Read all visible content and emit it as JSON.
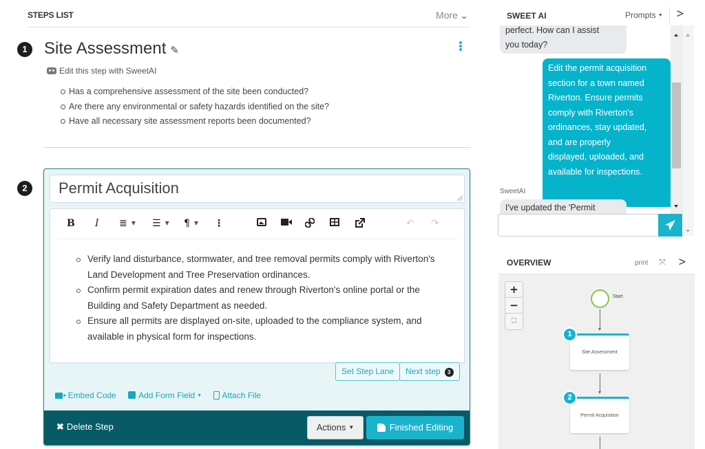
{
  "steps_list": {
    "title": "STEPS LIST",
    "more_label": "More",
    "more_icon": "chevron-down-icon"
  },
  "step1": {
    "number": "1",
    "title": "Site Assessment",
    "edit_with_ai_label": "Edit this step with SweetAI",
    "items": [
      "Has a comprehensive assessment of the site been conducted?",
      "Are there any environmental or safety hazards identified on the site?",
      "Have all necessary site assessment reports been documented?"
    ]
  },
  "step2": {
    "number": "2",
    "title_value": "Permit Acquisition",
    "toolbar": {
      "bold": "B",
      "italic": "I",
      "ordered_list": "≣",
      "unordered_list": "☰",
      "paragraph": "¶",
      "more": "⋮",
      "image_icon": "image-icon",
      "video_icon": "video-icon",
      "link_icon": "link-icon",
      "table_icon": "table-icon",
      "external_icon": "external-link-icon",
      "undo": "↶",
      "redo": "↷"
    },
    "body_items": [
      "Verify land disturbance, stormwater, and tree removal permits comply with Riverton's Land Development and Tree Preservation ordinances.",
      "Confirm permit expiration dates and renew through Riverton's online portal or the Building and Safety Department as needed.",
      "Ensure all permits are displayed on-site, uploaded to the compliance system, and available in physical form for inspections."
    ],
    "set_step_lane_label": "Set Step Lane",
    "next_step_label": "Next step",
    "next_step_number": "3",
    "embed_code_label": "Embed Code",
    "add_form_field_label": "Add Form Field",
    "attach_file_label": "Attach File",
    "delete_step_label": "Delete Step",
    "actions_label": "Actions",
    "finished_editing_label": "Finished Editing"
  },
  "sweet_ai": {
    "title": "SWEET AI",
    "prompts_label": "Prompts",
    "messages": [
      {
        "role": "ai",
        "text_lines": [
          "perfect. How can I assist",
          "you today?"
        ]
      },
      {
        "role": "user",
        "text_lines": [
          "Edit the permit acquisition",
          "section for a town named",
          "Riverton. Ensure permits",
          "comply with Riverton's",
          "ordinances, stay updated,",
          "and are properly",
          "displayed, uploaded, and",
          "available for inspections."
        ]
      },
      {
        "role": "ai",
        "sender": "SweetAI",
        "text_lines": [
          "I've updated the 'Permit"
        ]
      }
    ],
    "input_value": "",
    "input_placeholder": ""
  },
  "overview": {
    "title": "OVERVIEW",
    "print_label": "print",
    "zoom_in": "+",
    "zoom_out": "−",
    "fit": "⛶",
    "start_label": "Start",
    "nodes": [
      {
        "number": "1",
        "label": "Site Assessment"
      },
      {
        "number": "2",
        "label": "Permit Acquisition"
      }
    ]
  },
  "colors": {
    "accent": "#1ab3cc",
    "footer_bar": "#075a66",
    "user_bubble": "#05b3cb",
    "ai_bubble": "#e8eaed",
    "start_node": "#8bc34a"
  }
}
